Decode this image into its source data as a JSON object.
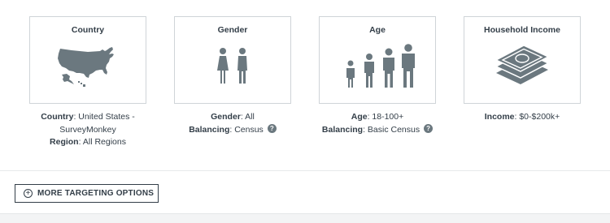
{
  "colors": {
    "text": "#333e48",
    "icon": "#6b787f",
    "border": "#cfd4d8"
  },
  "cards": [
    {
      "title": "Country",
      "icon": "usa-map-icon",
      "lines": [
        {
          "label": "Country",
          "value": ": United States -"
        },
        {
          "label": "",
          "value": "SurveyMonkey"
        },
        {
          "label": "Region",
          "value": ": All Regions"
        }
      ]
    },
    {
      "title": "Gender",
      "icon": "gender-people-icon",
      "lines": [
        {
          "label": "Gender",
          "value": ": All"
        },
        {
          "label": "Balancing",
          "value": ": Census",
          "help": "?"
        }
      ]
    },
    {
      "title": "Age",
      "icon": "age-people-icon",
      "lines": [
        {
          "label": "Age",
          "value": ": 18-100+"
        },
        {
          "label": "Balancing",
          "value": ": Basic Census",
          "help": "?"
        }
      ]
    },
    {
      "title": "Household Income",
      "icon": "money-stack-icon",
      "lines": [
        {
          "label": "Income",
          "value": ": $0-$200k+"
        }
      ]
    }
  ],
  "more_button": {
    "icon": "plus-circle-icon",
    "label": "MORE TARGETING OPTIONS"
  }
}
